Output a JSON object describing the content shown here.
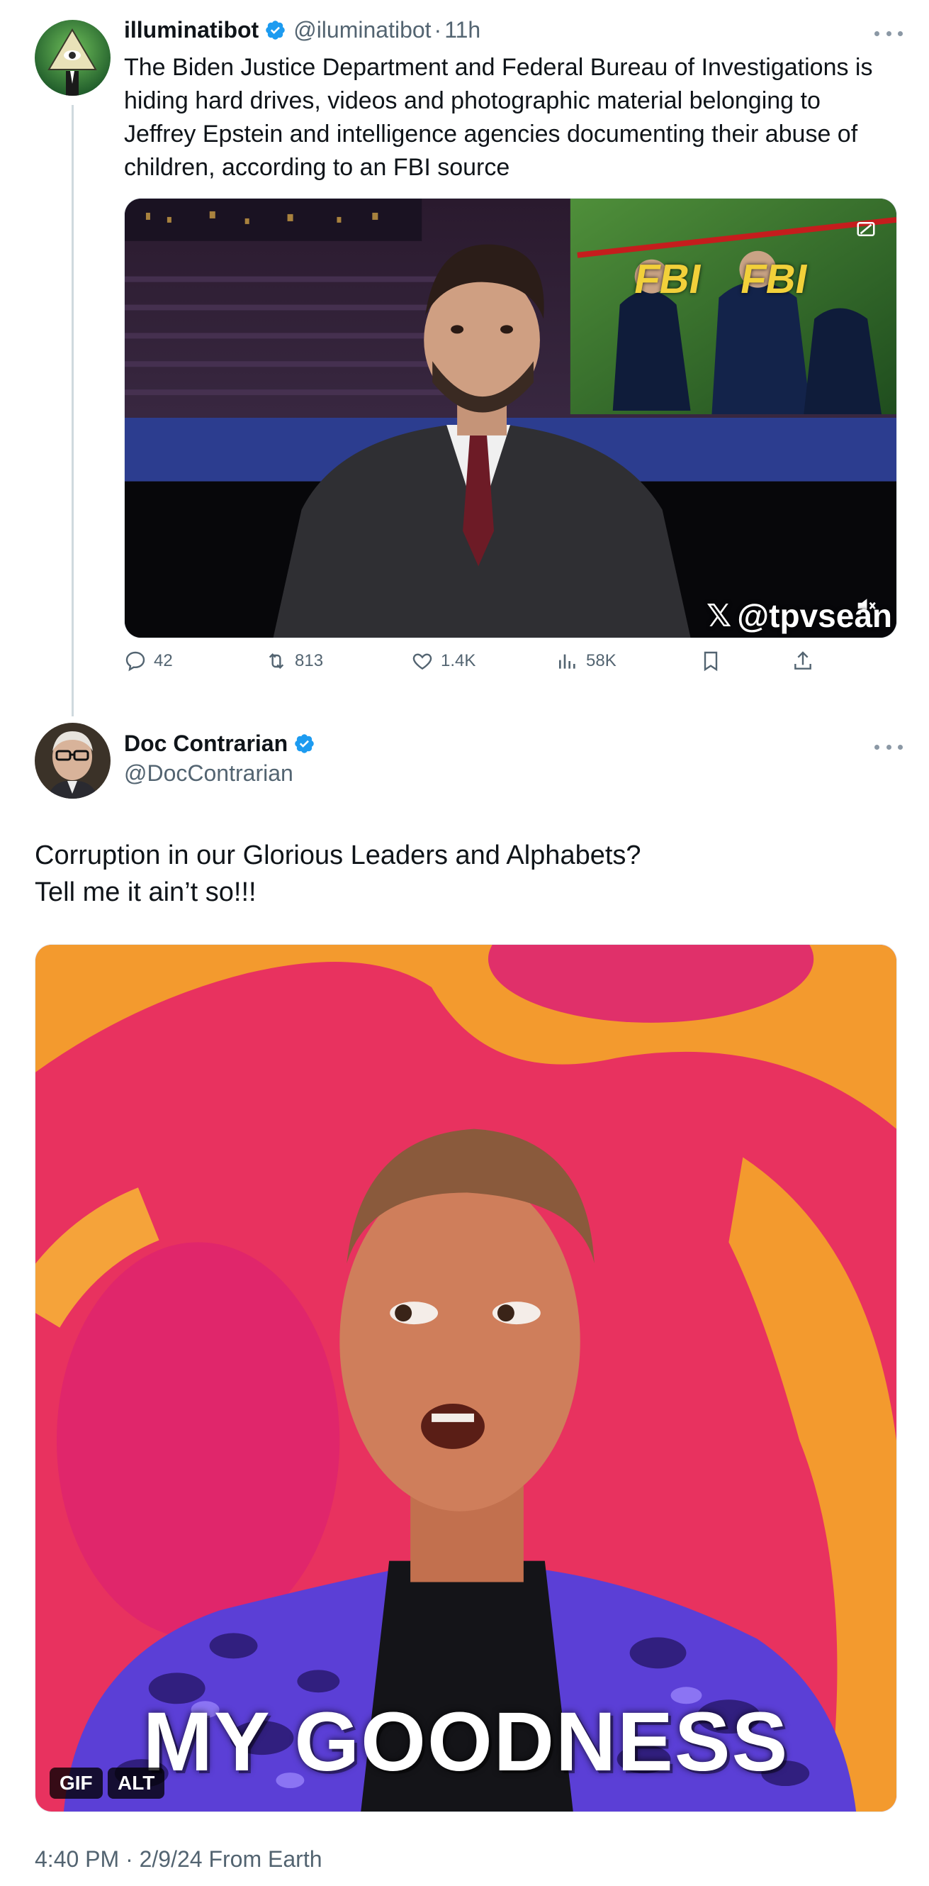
{
  "original_tweet": {
    "display_name": "illuminatibot",
    "handle": "@iluminatibot",
    "separator": "·",
    "time": "11h",
    "text": "The Biden Justice Department and Federal Bureau of Investigations is\nhiding hard drives, videos and photographic material belonging to\nJeffrey Epstein and intelligence agencies documenting their abuse of\nchildren, according to an FBI source",
    "video": {
      "watermark_handle": "@tpvsean",
      "background_sign_1": "FBI",
      "background_sign_2": "FBI"
    },
    "metrics": {
      "replies": "42",
      "reposts": "813",
      "likes": "1.4K",
      "views": "58K"
    }
  },
  "reply_tweet": {
    "display_name": "Doc Contrarian",
    "handle": "@DocContrarian",
    "text": "Corruption in our Glorious Leaders and Alphabets?\nTell me it ain’t so!!!",
    "media": {
      "caption": "MY GOODNESS",
      "gif_badge": "GIF",
      "alt_badge": "ALT"
    },
    "timestamp": "4:40 PM · 2/9/24 From Earth"
  },
  "colors": {
    "verified_blue": "#1d9bf0",
    "secondary_text": "#536471",
    "thread_line": "#cfd9de"
  },
  "icons": [
    "verified-badge-icon",
    "more-icon",
    "reply-icon",
    "repost-icon",
    "like-icon",
    "views-icon",
    "bookmark-icon",
    "share-icon",
    "mute-icon",
    "x-logo-icon"
  ]
}
